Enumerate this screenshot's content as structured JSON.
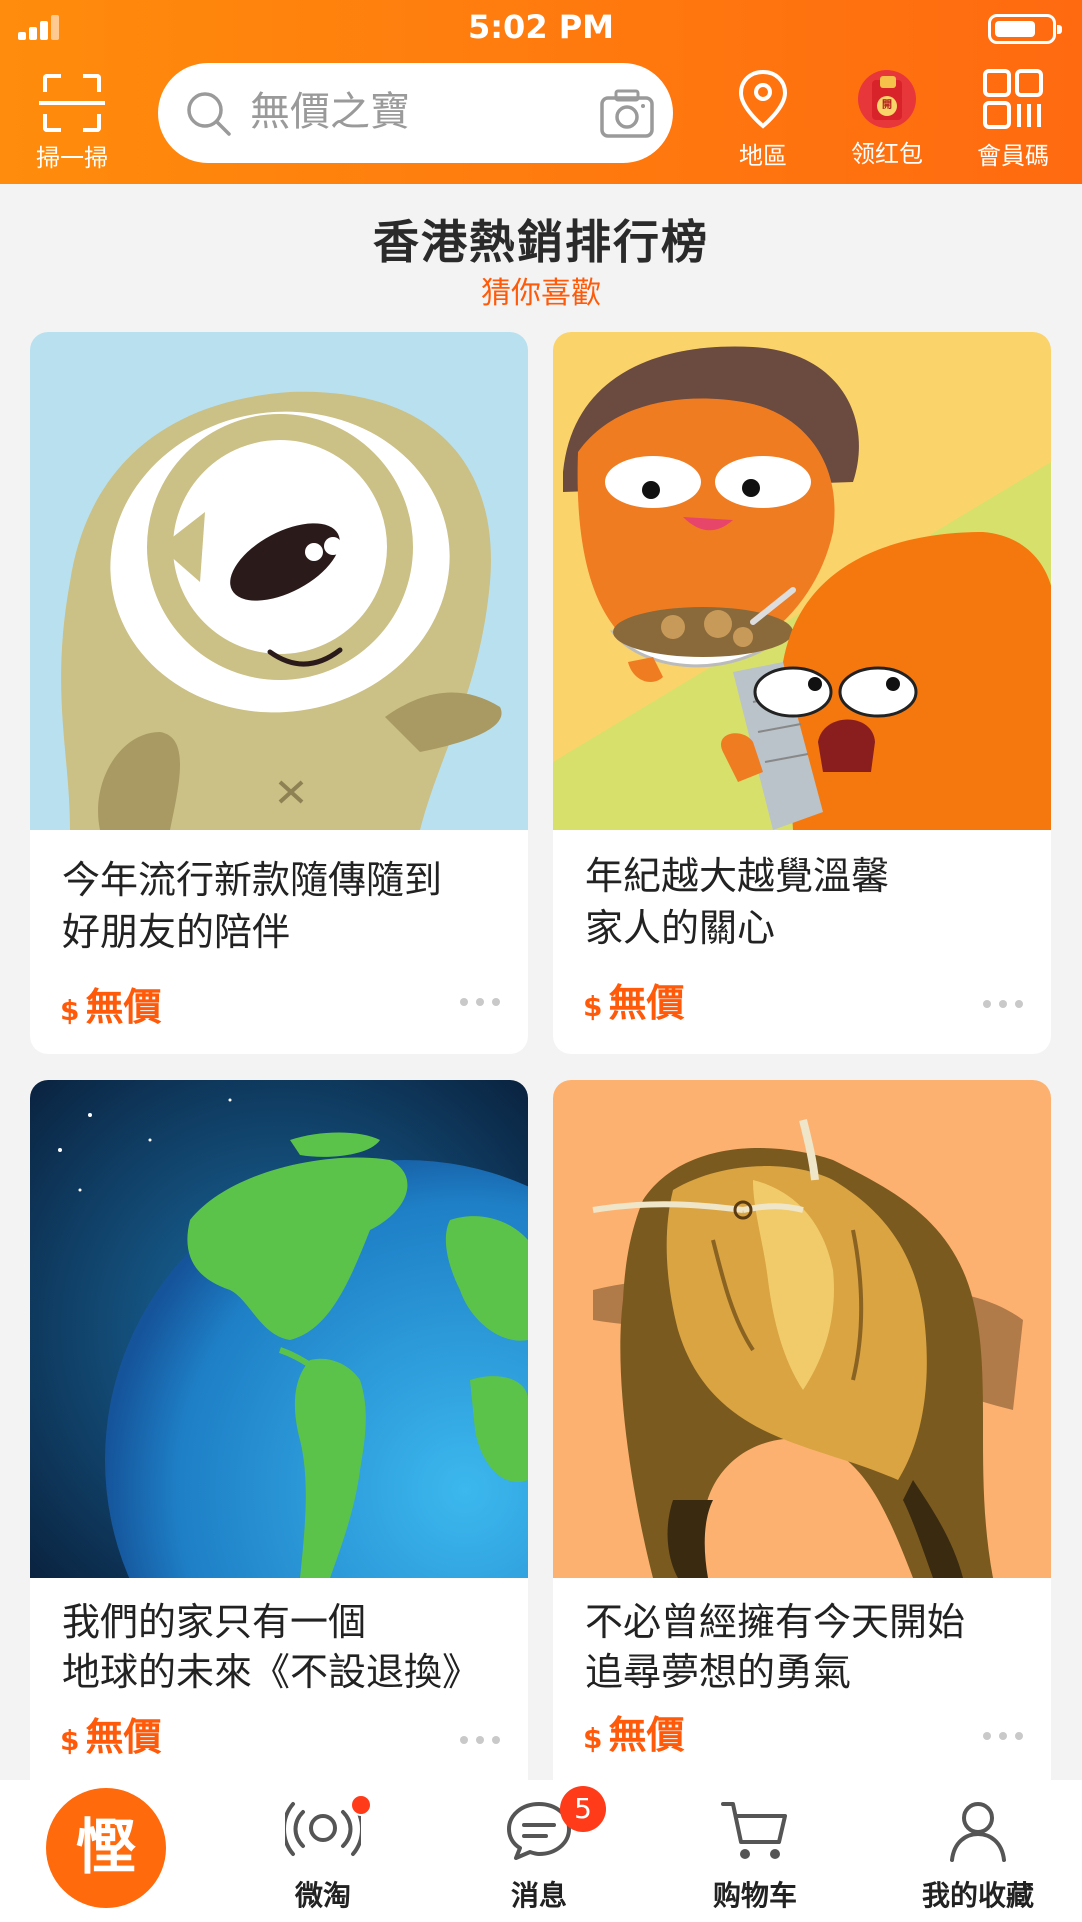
{
  "status_bar": {
    "time": "5:02 PM"
  },
  "header": {
    "scan_label": "掃一掃",
    "search_placeholder": "無價之寶",
    "location_label": "地區",
    "red_packet_label": "领红包",
    "red_packet_seal": "開",
    "member_code_label": "會員碼"
  },
  "section": {
    "title": "香港熱銷排行榜",
    "subtitle": "猜你喜歡"
  },
  "products": [
    {
      "title_line1": "今年流行新款隨傳隨到",
      "title_line2": "好朋友的陪伴",
      "currency": "$",
      "price": "無價"
    },
    {
      "title_line1": "年紀越大越覺溫馨",
      "title_line2": "家人的關心",
      "currency": "$",
      "price": "無價"
    },
    {
      "title_line1": "我們的家只有一個",
      "title_line2": "地球的未來《不設退換》",
      "currency": "$",
      "price": "無價"
    },
    {
      "title_line1": "不必曾經擁有今天開始",
      "title_line2": "追尋夢想的勇氣",
      "currency": "$",
      "price": "無價"
    }
  ],
  "bottom_nav": {
    "home_logo": "慳",
    "items": [
      {
        "label": "微淘"
      },
      {
        "label": "消息",
        "badge": "5"
      },
      {
        "label": "购物车"
      },
      {
        "label": "我的收藏"
      }
    ]
  },
  "colors": {
    "brand_orange": "#ff6a10",
    "price_orange": "#ff5a0a",
    "badge_red": "#ff3b1a"
  }
}
